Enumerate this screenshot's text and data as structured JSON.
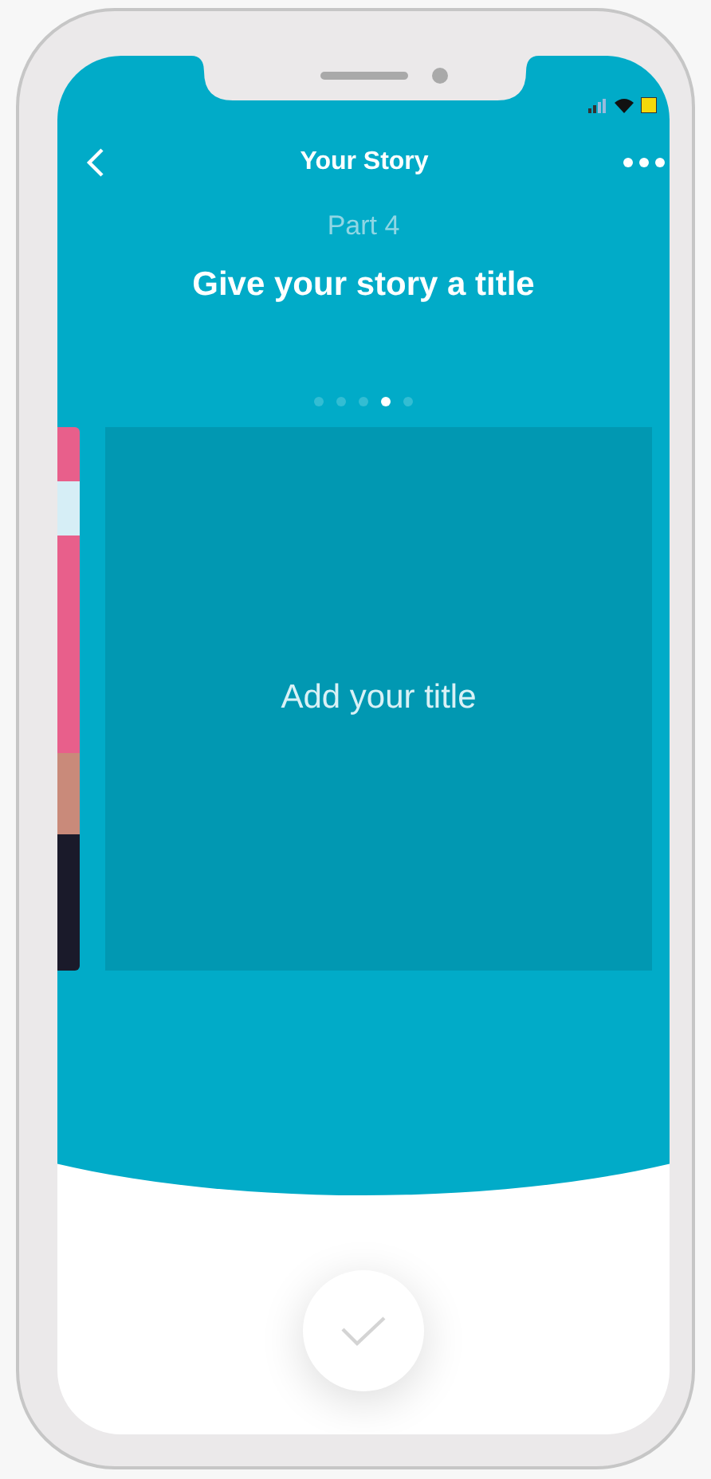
{
  "header": {
    "title": "Your Story"
  },
  "step_label": "Part 4",
  "heading": "Give your story a title",
  "pager": [
    {
      "selected": false
    },
    {
      "selected": false
    },
    {
      "selected": false
    },
    {
      "selected": true
    },
    {
      "selected": false
    }
  ],
  "title_field": {
    "placeholder": "Add your title"
  }
}
